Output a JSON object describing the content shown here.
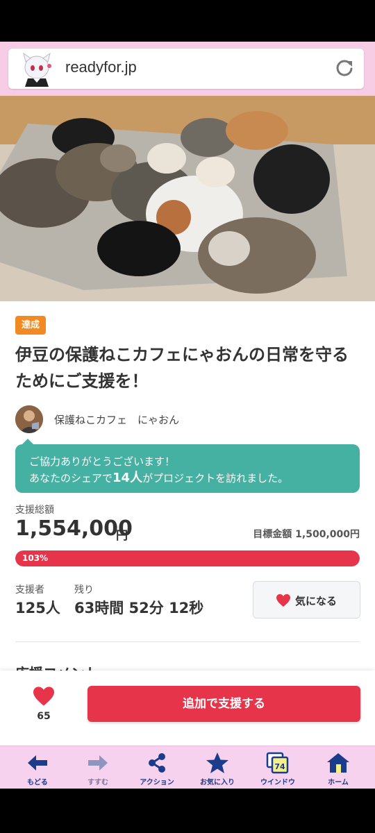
{
  "browser": {
    "url": "readyfor.jp"
  },
  "project": {
    "status_badge": "達成",
    "title": "伊豆の保護ねこカフェにゃおんの日常を守るためにご支援を！",
    "owner_name": "保護ねこカフェ　にゃおん",
    "thanks_line1": "ご協力ありがとうございます！",
    "thanks_line2_prefix": "あなたのシェアで",
    "thanks_line2_count": "14人",
    "thanks_line2_suffix": "がプロジェクトを訪れました。",
    "total_label": "支援総額",
    "total_amount": "1,554,000",
    "total_unit": "円",
    "goal_label": "目標金額",
    "goal_amount": "1,500,000円",
    "progress_percent": 103,
    "progress_label": "103%",
    "backers_label": "支援者",
    "backers_value": "125人",
    "remaining_label": "残り",
    "remaining_value": "63時間 52分 12秒",
    "favorite_label": "気になる",
    "section_heading": "応援コメント"
  },
  "bottom_bar": {
    "like_count": "65",
    "support_button": "追加で支援する"
  },
  "nav": {
    "back": "もどる",
    "forward": "すすむ",
    "action": "アクション",
    "bookmarks": "お気に入り",
    "windows": "ウインドウ",
    "window_count": "74",
    "home": "ホーム"
  },
  "colors": {
    "accent_red": "#e6344a",
    "teal": "#45b1a3",
    "badge_orange": "#f18a22",
    "nav_pink": "#f7d2ee",
    "nav_blue": "#1a3c8a"
  }
}
